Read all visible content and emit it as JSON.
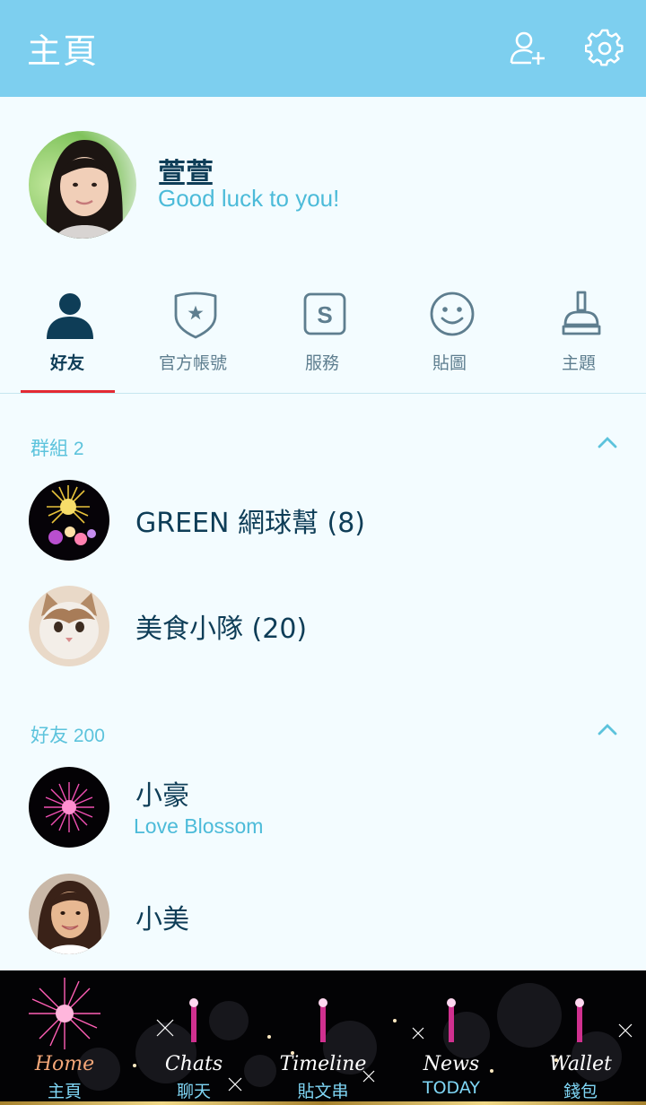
{
  "header": {
    "title": "主頁",
    "add_friend_icon": "add-friend-icon",
    "settings_icon": "gear-icon"
  },
  "profile": {
    "name": "萱萱",
    "status": "Good luck to you!"
  },
  "tabs": [
    {
      "label": "好友",
      "icon": "person-icon",
      "active": true
    },
    {
      "label": "官方帳號",
      "icon": "shield-star-icon",
      "active": false
    },
    {
      "label": "服務",
      "icon": "service-s-icon",
      "active": false
    },
    {
      "label": "貼圖",
      "icon": "smiley-icon",
      "active": false
    },
    {
      "label": "主題",
      "icon": "brush-icon",
      "active": false
    }
  ],
  "groups": {
    "title": "群組 2",
    "items": [
      {
        "name": "GREEN 網球幫 (8)",
        "avatar": "gold-fireworks"
      },
      {
        "name": "美食小隊 (20)",
        "avatar": "cat"
      }
    ]
  },
  "friends": {
    "title": "好友 200",
    "items": [
      {
        "name": "小豪",
        "status": "Love Blossom",
        "avatar": "pink-firework"
      },
      {
        "name": "小美",
        "avatar": "woman"
      }
    ]
  },
  "bottom_nav": [
    {
      "en": "Home",
      "zh": "主頁",
      "active": true
    },
    {
      "en": "Chats",
      "zh": "聊天",
      "active": false
    },
    {
      "en": "Timeline",
      "zh": "貼文串",
      "active": false
    },
    {
      "en": "News",
      "zh": "TODAY",
      "active": false
    },
    {
      "en": "Wallet",
      "zh": "錢包",
      "active": false
    }
  ],
  "colors": {
    "header": "#7dcfef",
    "background": "#f3fcff",
    "accent_text": "#4cbbd9",
    "name_text": "#0e3d57",
    "active_underline": "#e32a33"
  }
}
